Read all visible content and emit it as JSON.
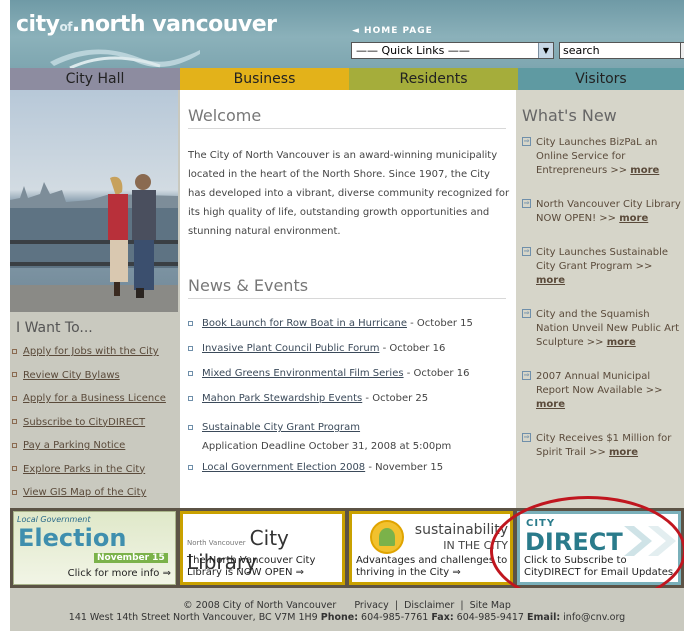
{
  "header": {
    "logo_text": "city of north vancouver",
    "logo_city": "city",
    "logo_of": "of",
    "logo_rest": "north vancouver",
    "home_link": "◄ HOME PAGE",
    "quick_links": "—— Quick Links ——",
    "search_value": "search"
  },
  "nav": {
    "city_hall": "City Hall",
    "business": "Business",
    "residents": "Residents",
    "visitors": "Visitors"
  },
  "left": {
    "heading": "I Want To...",
    "links": [
      "Apply for Jobs with the City",
      "Review City Bylaws",
      "Apply for a Business Licence",
      "Subscribe to CityDIRECT",
      "Pay a Parking Notice",
      "Explore Parks in the City",
      "View GIS Map of the City"
    ]
  },
  "welcome": {
    "heading": "Welcome",
    "text": "The City of North Vancouver is an award-winning municipality located in the heart of the North Shore. Since 1907, the City has developed into a vibrant, diverse community recognized for its high quality of life, outstanding growth opportunities and stunning natural environment."
  },
  "news": {
    "heading": "News & Events",
    "items": [
      {
        "link": "Book Launch for Row Boat in a Hurricane",
        "date": " - October 15"
      },
      {
        "link": "Invasive Plant Council Public Forum",
        "date": " - October 16"
      },
      {
        "link": "Mixed Greens Environmental Film Series",
        "date": " - October 16"
      },
      {
        "link": "Mahon Park Stewardship Events",
        "date": " - October 25"
      },
      {
        "link": "Sustainable City Grant Program",
        "date": "",
        "extra": "Application Deadline October 31, 2008 at 5:00pm"
      },
      {
        "link": "Local Government Election 2008",
        "date": " - November 15"
      }
    ]
  },
  "whats_new": {
    "heading": "What's New",
    "items": [
      {
        "text": "City Launches BizPaL an Online Service for Entrepreneurs >> ",
        "more": "more"
      },
      {
        "text": "North Vancouver City Library NOW OPEN! >> ",
        "more": "more"
      },
      {
        "text": "City Launches Sustainable City Grant Program >> ",
        "more": "more"
      },
      {
        "text": "City and the Squamish Nation Unveil New Public Art Sculpture >> ",
        "more": "more"
      },
      {
        "text": "2007 Annual Municipal Report Now Available >> ",
        "more": "more"
      },
      {
        "text": "City Receives $1 Million for Spirit Trail >> ",
        "more": "more"
      }
    ]
  },
  "banners": {
    "election_tag": "Local Government",
    "election_title": "Election",
    "election_date": "November 15",
    "election_link": "Click for more info ⇒",
    "library_small": "North Vancouver",
    "library_title": "City Library",
    "library_text": "The North Vancouver City Library is NOW OPEN ⇒",
    "sustain_title": "sustainability",
    "sustain_sub": "IN THE CITY",
    "sustain_text": "Advantages and challenges to thriving in the City ⇒",
    "direct_city": "CITY",
    "direct_title": "DIRECT",
    "direct_text": "Click to Subscribe to CityDIRECT for Email Updates"
  },
  "footer": {
    "copyright": "© 2008 City of North Vancouver",
    "privacy": "Privacy",
    "disclaimer": "Disclaimer",
    "sitemap": "Site Map",
    "address": "141 West 14th Street  North Vancouver, BC  V7M 1H9",
    "phone_label": "Phone:",
    "phone": " 604-985-7761",
    "fax_label": "Fax:",
    "fax": " 604-985-9417",
    "email_label": "Email:",
    "email": " info@cnv.org"
  }
}
